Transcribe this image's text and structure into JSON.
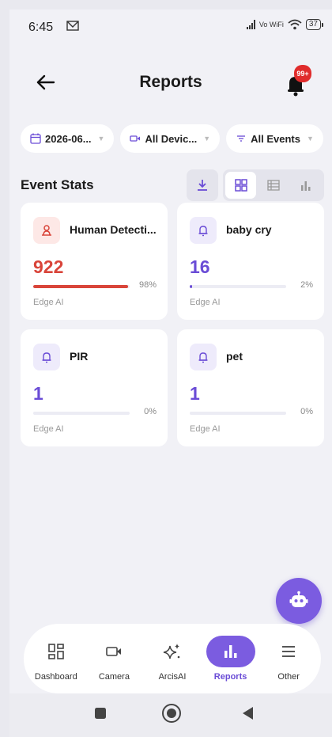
{
  "status": {
    "time": "6:45",
    "network_label": "Vo WiFi",
    "battery": "37"
  },
  "header": {
    "title": "Reports",
    "notification_badge": "99+"
  },
  "filters": [
    {
      "label": "2026-06...",
      "icon": "calendar-icon"
    },
    {
      "label": "All Devic...",
      "icon": "camera-icon"
    },
    {
      "label": "All Events",
      "icon": "filter-icon"
    }
  ],
  "event_stats": {
    "title": "Event Stats",
    "view_mode": "grid",
    "cards": [
      {
        "name": "Human Detecti...",
        "count": "922",
        "percent": "98%",
        "fraction": 0.98,
        "source": "Edge AI",
        "icon": "person-icon",
        "accent": "#d9453a",
        "icon_bg": "#fde8e6"
      },
      {
        "name": "baby cry",
        "count": "16",
        "percent": "2%",
        "fraction": 0.02,
        "source": "Edge AI",
        "icon": "bell-icon",
        "accent": "#6a4cd6",
        "icon_bg": "#eeebfb"
      },
      {
        "name": "PIR",
        "count": "1",
        "percent": "0%",
        "fraction": 0,
        "source": "Edge AI",
        "icon": "bell-icon",
        "accent": "#6a4cd6",
        "icon_bg": "#eeebfb"
      },
      {
        "name": "pet",
        "count": "1",
        "percent": "0%",
        "fraction": 0,
        "source": "Edge AI",
        "icon": "bell-icon",
        "accent": "#6a4cd6",
        "icon_bg": "#eeebfb"
      }
    ]
  },
  "nav": {
    "items": [
      {
        "label": "Dashboard",
        "icon": "dashboard-icon"
      },
      {
        "label": "Camera",
        "icon": "camera-icon"
      },
      {
        "label": "ArcisAI",
        "icon": "sparkle-icon"
      },
      {
        "label": "Reports",
        "icon": "bar-chart-icon",
        "active": true
      },
      {
        "label": "Other",
        "icon": "menu-icon"
      }
    ]
  },
  "colors": {
    "accent": "#7b5ce0",
    "danger": "#d9453a",
    "background": "#f1f1f6"
  }
}
